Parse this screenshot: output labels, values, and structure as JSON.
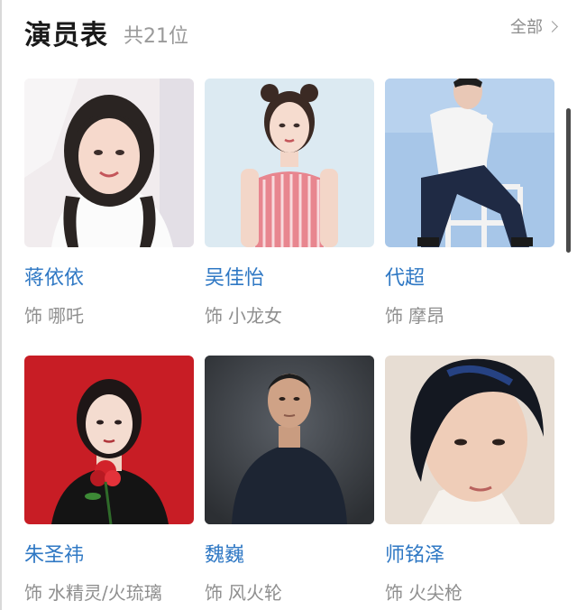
{
  "header": {
    "title": "演员表",
    "count": "共21位",
    "see_all": "全部"
  },
  "cast": [
    {
      "name": "蒋依依",
      "role_prefix": "饰",
      "role": "哪吒"
    },
    {
      "name": "吴佳怡",
      "role_prefix": "饰",
      "role": "小龙女"
    },
    {
      "name": "代超",
      "role_prefix": "饰",
      "role": "摩昂"
    },
    {
      "name": "朱圣祎",
      "role_prefix": "饰",
      "role": "水精灵/火琉璃"
    },
    {
      "name": "魏巍",
      "role_prefix": "饰",
      "role": "风火轮"
    },
    {
      "name": "师铭泽",
      "role_prefix": "饰",
      "role": "火尖枪"
    }
  ],
  "colors": {
    "name_link": "#2f78c4",
    "role_text": "#8f8f8f",
    "title": "#1a1a1a"
  }
}
